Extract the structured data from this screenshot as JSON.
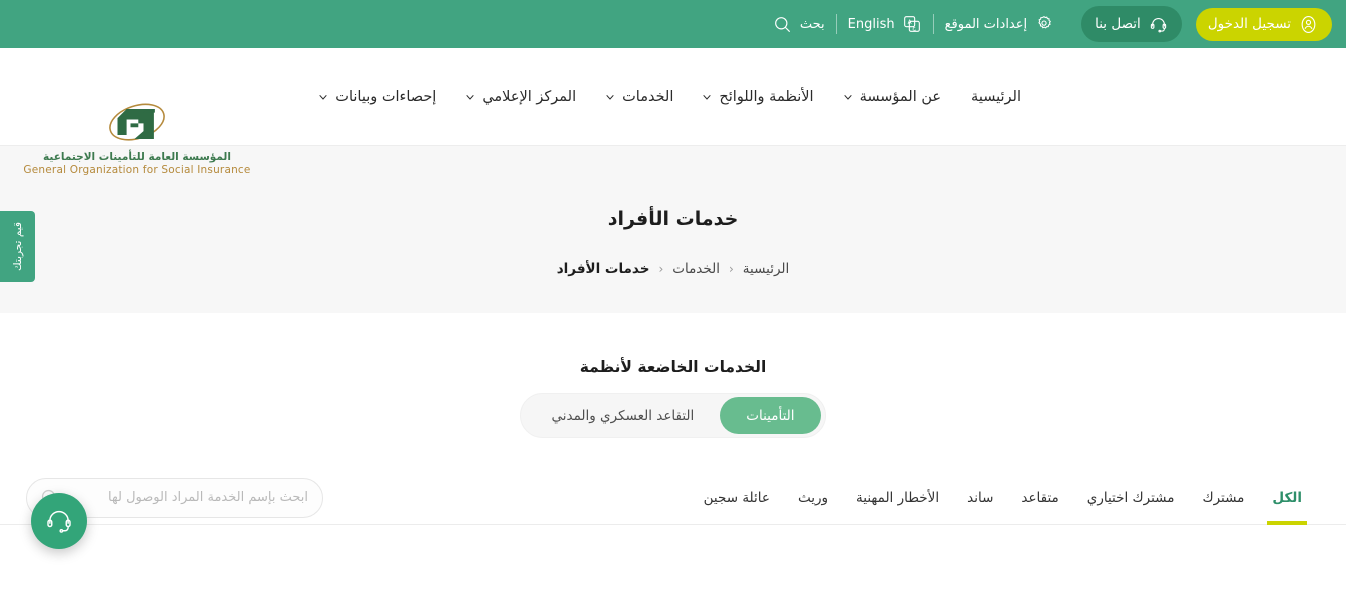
{
  "topbar": {
    "login_label": "تسجيل الدخول",
    "contact_label": "اتصل بنا",
    "site_settings_label": "إعدادات الموقع",
    "language_label": "English",
    "search_label": "بحث",
    "colors": {
      "bar": "#41a481",
      "login_bg": "#cbd400",
      "contact_bg": "#2f8b67"
    }
  },
  "brand": {
    "name_ar": "المؤسسة العامة للتأمينات الاجتماعية",
    "name_en": "General Organization for Social Insurance",
    "colors": {
      "mark_green": "#2f6b44",
      "mark_gold": "#b58a3c",
      "text_green": "#3d7a4f"
    }
  },
  "nav": {
    "items": [
      {
        "label": "الرئيسية",
        "has_dropdown": false
      },
      {
        "label": "عن المؤسسة",
        "has_dropdown": true
      },
      {
        "label": "الأنظمة واللوائح",
        "has_dropdown": true
      },
      {
        "label": "الخدمات",
        "has_dropdown": true
      },
      {
        "label": "المركز الإعلامي",
        "has_dropdown": true
      },
      {
        "label": "إحصاءات وبيانات",
        "has_dropdown": true
      }
    ]
  },
  "hero": {
    "title": "خدمات الأفراد",
    "breadcrumb": [
      {
        "label": "الرئيسية",
        "current": false
      },
      {
        "label": "الخدمات",
        "current": false
      },
      {
        "label": "خدمات الأفراد",
        "current": true
      }
    ],
    "separator": "‹",
    "rate_tab_label": "قيم تجربتك"
  },
  "content": {
    "section_title": "الخدمات الخاضعة لأنظمة",
    "system_toggle": {
      "options": [
        {
          "label": "التأمينات",
          "active": true
        },
        {
          "label": "التقاعد العسكري والمدني",
          "active": false
        }
      ],
      "active_color": "#68bc8f"
    },
    "search": {
      "placeholder": "ابحث بإسم الخدمة المراد الوصول لها",
      "value": ""
    },
    "filter_tabs": [
      {
        "label": "الكل",
        "active": true
      },
      {
        "label": "مشترك",
        "active": false
      },
      {
        "label": "مشترك اختياري",
        "active": false
      },
      {
        "label": "متقاعد",
        "active": false
      },
      {
        "label": "ساند",
        "active": false
      },
      {
        "label": "الأخطار المهنية",
        "active": false
      },
      {
        "label": "وريث",
        "active": false
      },
      {
        "label": "عائلة سجين",
        "active": false
      }
    ],
    "active_tab_underline_color": "#cbd400",
    "active_tab_text_color": "#2e8f6a"
  },
  "floating": {
    "chat_label": "headset-icon",
    "color": "#33a579"
  }
}
